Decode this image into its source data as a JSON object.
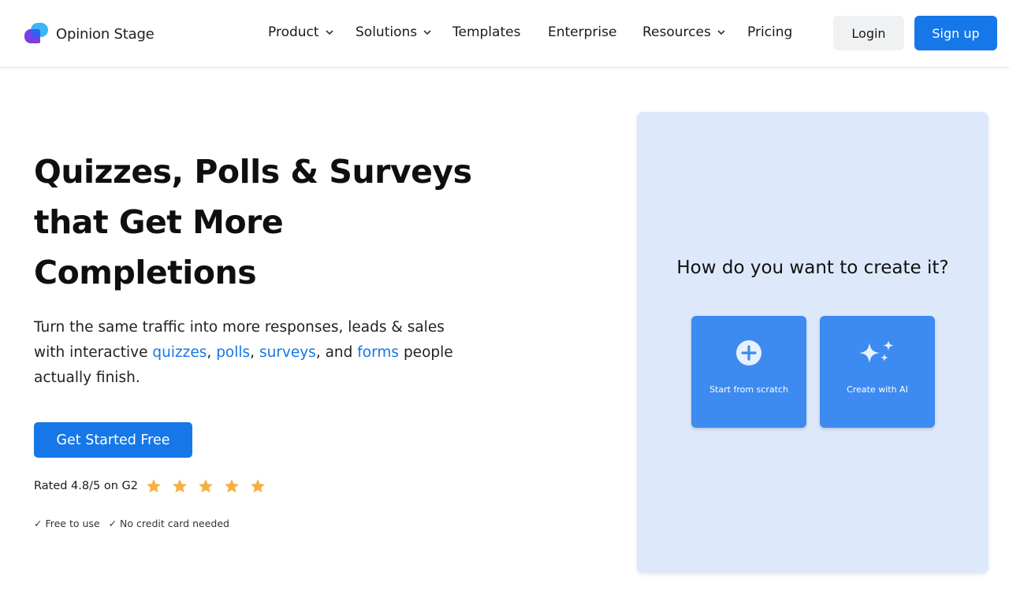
{
  "brand": {
    "name": "Opinion Stage"
  },
  "nav": {
    "items": [
      {
        "label": "Product",
        "has_dropdown": true
      },
      {
        "label": "Solutions",
        "has_dropdown": true
      },
      {
        "label": "Templates",
        "has_dropdown": false
      },
      {
        "label": "Enterprise",
        "has_dropdown": false
      },
      {
        "label": "Resources",
        "has_dropdown": true
      },
      {
        "label": "Pricing",
        "has_dropdown": false
      }
    ]
  },
  "auth": {
    "login_label": "Login",
    "signup_label": "Sign up"
  },
  "hero": {
    "title_lines": [
      "Quizzes, Polls & Surveys",
      "that Get More",
      "Completions"
    ],
    "subtitle_parts": {
      "lead": "Turn the same traffic into more responses, leads & sales with interactive ",
      "link_quizzes": "quizzes",
      "comma1": ", ",
      "link_polls": "polls",
      "comma2": ", ",
      "link_surveys": "surveys",
      "and": ", and ",
      "link_forms": "forms",
      "tail": " people actually finish."
    },
    "cta_label": "Get Started Free",
    "rating_text": "Rated 4.8/5 on G2",
    "rating_value": 4.8,
    "rating_max": 5,
    "perks": [
      "✓ Free to use",
      "✓ No credit card needed"
    ]
  },
  "create_card": {
    "title": "How do you want to create it?",
    "options": [
      {
        "label": "Start from scratch",
        "icon": "plus-circle-icon"
      },
      {
        "label": "Create with AI",
        "icon": "sparkles-icon"
      }
    ]
  },
  "colors": {
    "accent": "#1677e8",
    "card_bg": "#dde9fb",
    "option_bg": "#3d8af1",
    "star": "#f5b041",
    "login_bg": "#f0f1f2"
  }
}
